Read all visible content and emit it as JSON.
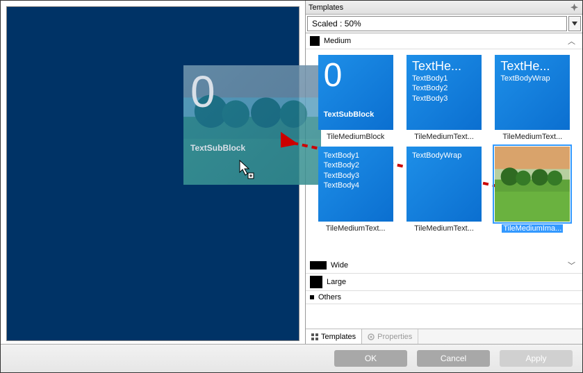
{
  "panel": {
    "title": "Templates"
  },
  "scale": {
    "text": "Scaled : 50%"
  },
  "groups": {
    "medium": "Medium",
    "wide": "Wide",
    "large": "Large",
    "others": "Others"
  },
  "tiles": [
    {
      "label": "TileMediumBlock",
      "big": "0",
      "sub": "TextSubBlock"
    },
    {
      "label": "TileMediumText...",
      "hdr": "TextHe...",
      "lines": [
        "TextBody1",
        "TextBody2",
        "TextBody3"
      ]
    },
    {
      "label": "TileMediumText...",
      "hdr": "TextHe...",
      "lines": [
        "TextBodyWrap"
      ]
    },
    {
      "label": "TileMediumText...",
      "lines": [
        "TextBody1",
        "TextBody2",
        "TextBody3",
        "TextBody4"
      ]
    },
    {
      "label": "TileMediumText...",
      "lines": [
        "TextBodyWrap"
      ]
    },
    {
      "label": "TileMediumIma...",
      "image": true,
      "selected": true
    }
  ],
  "ghost": {
    "big": "0",
    "sub": "TextSubBlock"
  },
  "tabs": {
    "templates": "Templates",
    "properties": "Properties"
  },
  "buttons": {
    "ok": "OK",
    "cancel": "Cancel",
    "apply": "Apply"
  }
}
